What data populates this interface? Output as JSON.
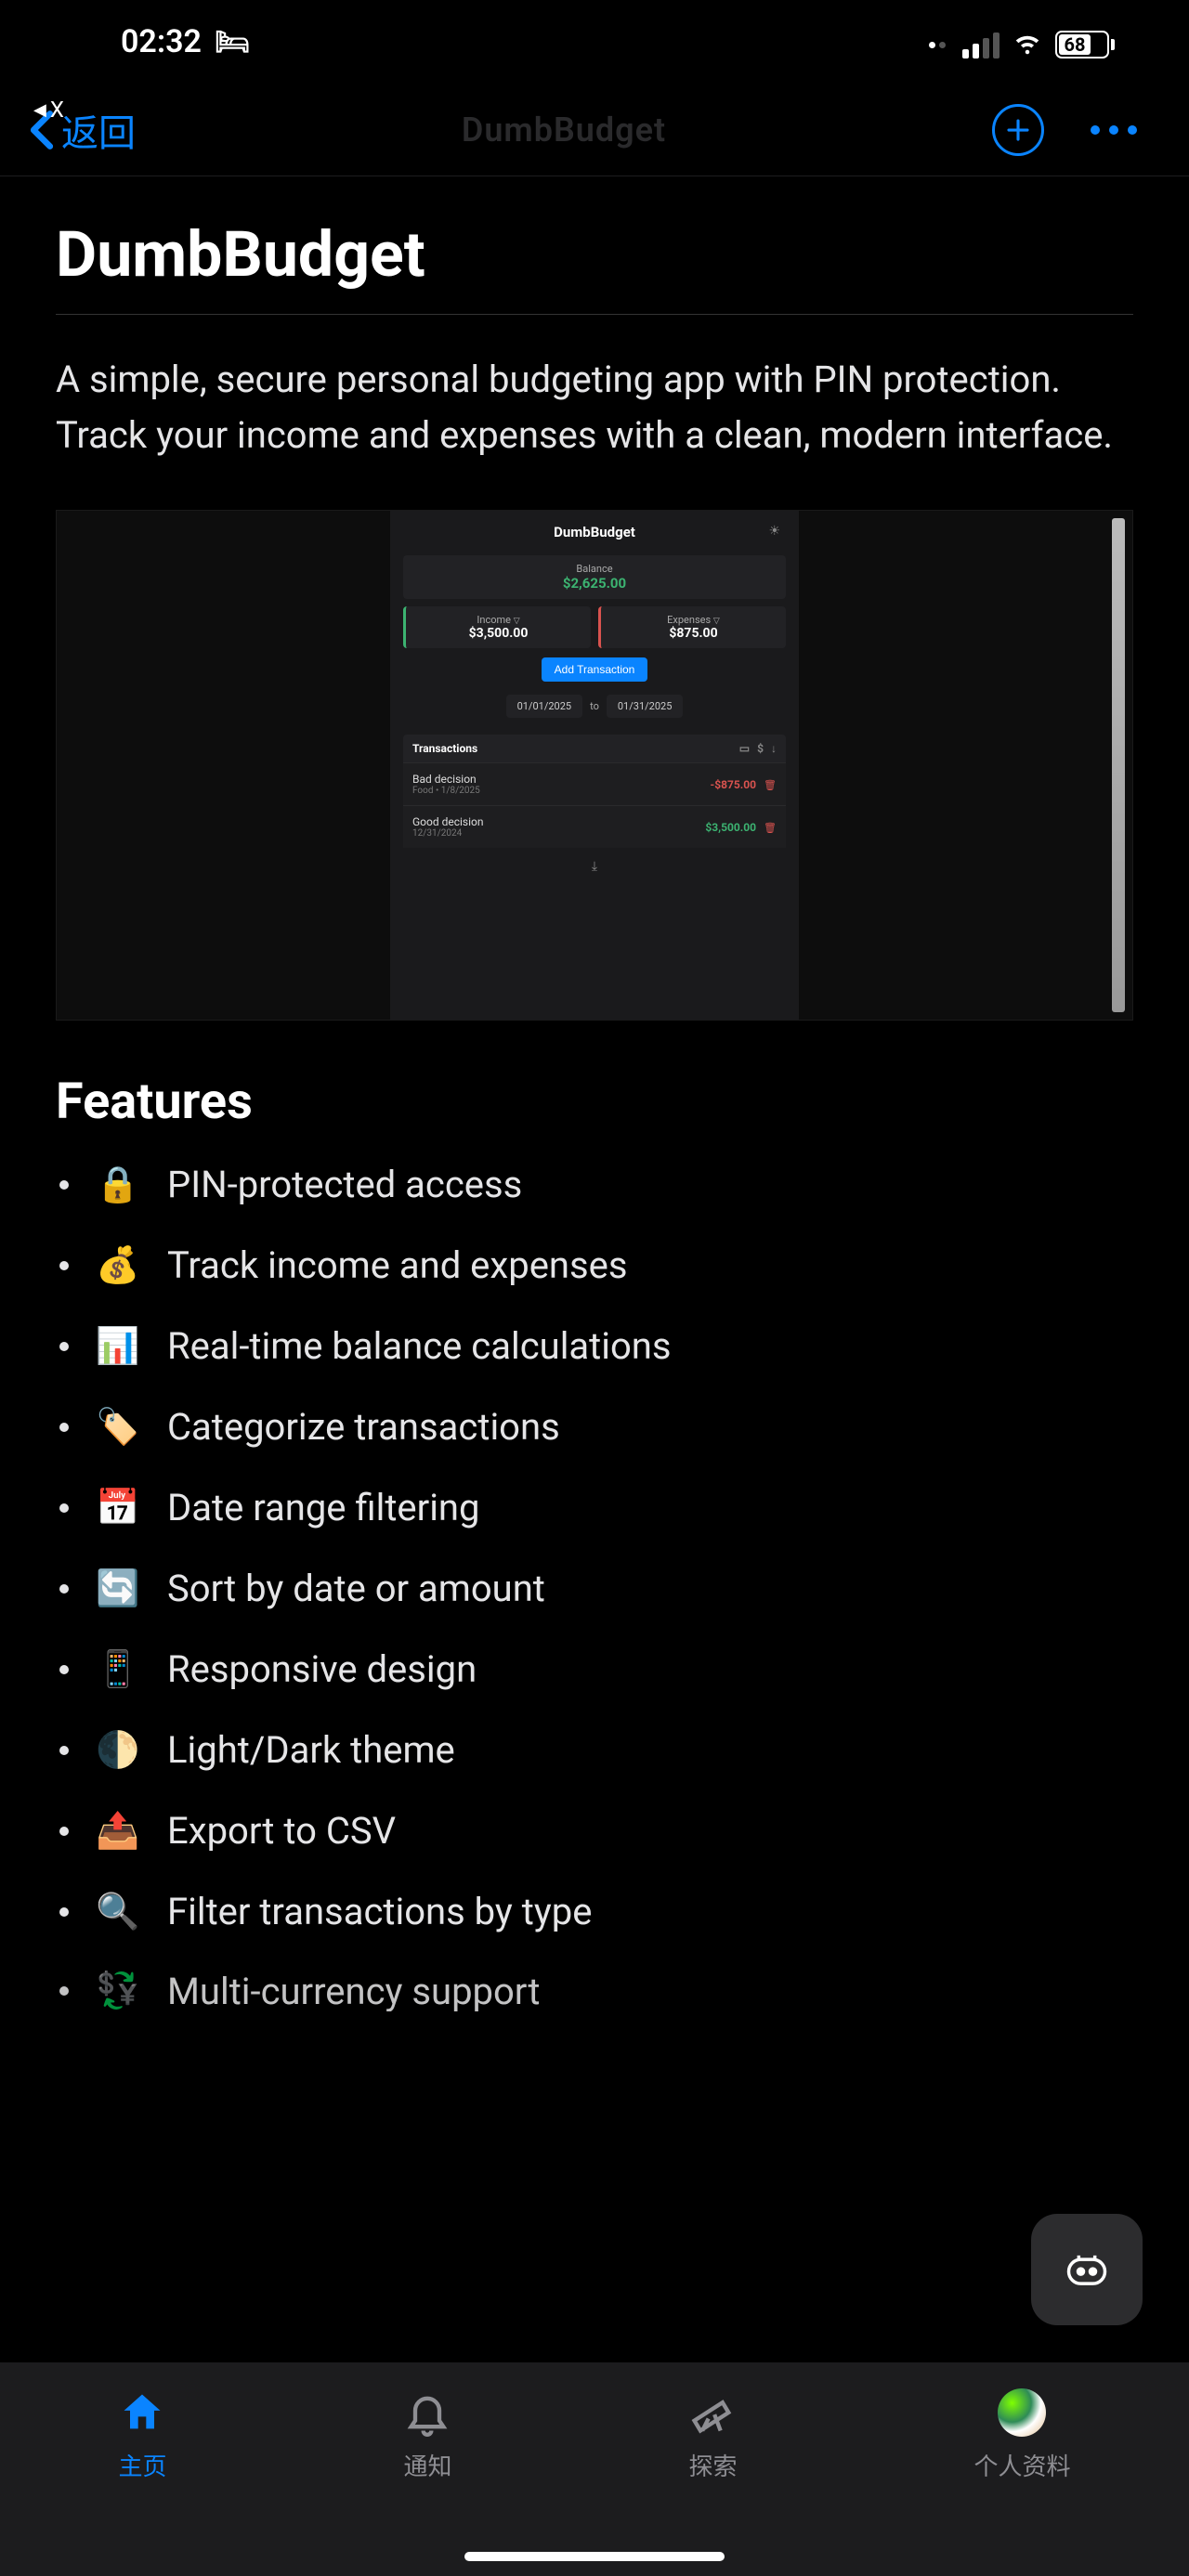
{
  "status": {
    "time": "02:32",
    "back_app": "X",
    "battery_pct": "68"
  },
  "nav": {
    "back_label": "返回",
    "title": "DumbBudget"
  },
  "page": {
    "title": "DumbBudget",
    "description": "A simple, secure personal budgeting app with PIN protection. Track your income and expenses with a clean, modern interface."
  },
  "screenshot": {
    "app_title": "DumbBudget",
    "balance_label": "Balance",
    "balance_value": "$2,625.00",
    "income_label": "Income",
    "income_value": "$3,500.00",
    "expenses_label": "Expenses",
    "expenses_value": "$875.00",
    "add_tx_label": "Add Transaction",
    "date_from": "01/01/2025",
    "date_to_label": "to",
    "date_to": "01/31/2025",
    "tx_header": "Transactions",
    "tx": [
      {
        "name": "Bad decision",
        "sub": "Food  •  1/8/2025",
        "amount": "-$875.00",
        "cls": "neg"
      },
      {
        "name": "Good decision",
        "sub": "12/31/2024",
        "amount": "$3,500.00",
        "cls": "pos"
      }
    ]
  },
  "features_heading": "Features",
  "features": [
    {
      "emoji": "🔒",
      "text": "PIN-protected access"
    },
    {
      "emoji": "💰",
      "text": "Track income and expenses"
    },
    {
      "emoji": "📊",
      "text": "Real-time balance calculations"
    },
    {
      "emoji": "🏷️",
      "text": "Categorize transactions"
    },
    {
      "emoji": "📅",
      "text": "Date range filtering"
    },
    {
      "emoji": "🔄",
      "text": "Sort by date or amount"
    },
    {
      "emoji": "📱",
      "text": "Responsive design"
    },
    {
      "emoji": "🌓",
      "text": "Light/Dark theme"
    },
    {
      "emoji": "📤",
      "text": "Export to CSV"
    },
    {
      "emoji": "🔍",
      "text": "Filter transactions by type"
    },
    {
      "emoji": "💱",
      "text": "Multi-currency support"
    }
  ],
  "tabs": [
    {
      "id": "home",
      "label": "主页",
      "active": true
    },
    {
      "id": "notifications",
      "label": "通知",
      "active": false
    },
    {
      "id": "explore",
      "label": "探索",
      "active": false
    },
    {
      "id": "profile",
      "label": "个人资料",
      "active": false
    }
  ]
}
